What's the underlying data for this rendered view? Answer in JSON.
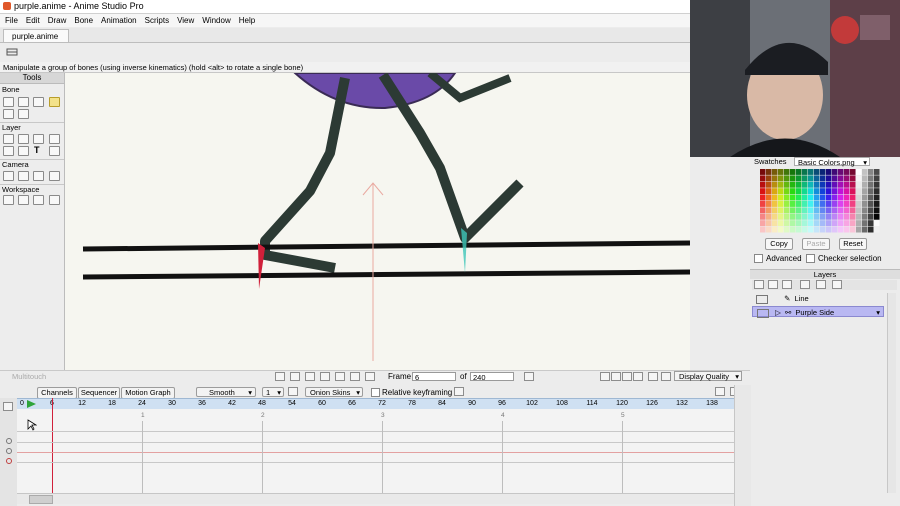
{
  "window": {
    "title": "purple.anime - Anime Studio Pro"
  },
  "menu": [
    "File",
    "Edit",
    "Draw",
    "Bone",
    "Animation",
    "Scripts",
    "View",
    "Window",
    "Help"
  ],
  "document_tab": {
    "label": "purple.anime",
    "modified_mark": "✐"
  },
  "status_message": "Manipulate a group of bones (using inverse kinematics) (hold <alt> to rotate a single bone)",
  "tools": {
    "header": "Tools",
    "groups": {
      "bone": "Bone",
      "layer": "Layer",
      "camera": "Camera",
      "workspace": "Workspace"
    }
  },
  "swatches": {
    "tab_label": "Swatches",
    "palette": "Basic Colors.png",
    "copy": "Copy",
    "paste": "Paste",
    "reset": "Reset",
    "advanced": "Advanced",
    "checker": "Checker selection"
  },
  "layers": {
    "header": "Layers",
    "items": [
      {
        "name": "Line",
        "selected": false
      },
      {
        "name": "Purple Side",
        "selected": true
      }
    ]
  },
  "transport": {
    "multitouch": "Multitouch",
    "frame_label": "Frame",
    "frame_value": "6",
    "of_label": "of",
    "total_frames": "240",
    "display_quality": "Display Quality"
  },
  "timeline": {
    "tabs": [
      "Channels",
      "Sequencer",
      "Motion Graph"
    ],
    "interpolation": "Smooth",
    "interval": "1",
    "onion_skins": "Onion Skins",
    "relative_keyframing": "Relative keyframing",
    "ruler_ticks": [
      "0",
      "6",
      "12",
      "18",
      "24",
      "30",
      "36",
      "42",
      "48",
      "54",
      "60",
      "66",
      "72",
      "78",
      "84",
      "90",
      "96",
      "102",
      "108",
      "114",
      "120",
      "126",
      "132",
      "138"
    ],
    "second_markers": [
      "1",
      "2",
      "3",
      "4",
      "5"
    ]
  },
  "colors": {
    "accent_layer": "#b9b8f2",
    "current_frame": "#d0203a",
    "ruler": "#cfe0f2",
    "purple_body": "#6a4aa8"
  }
}
